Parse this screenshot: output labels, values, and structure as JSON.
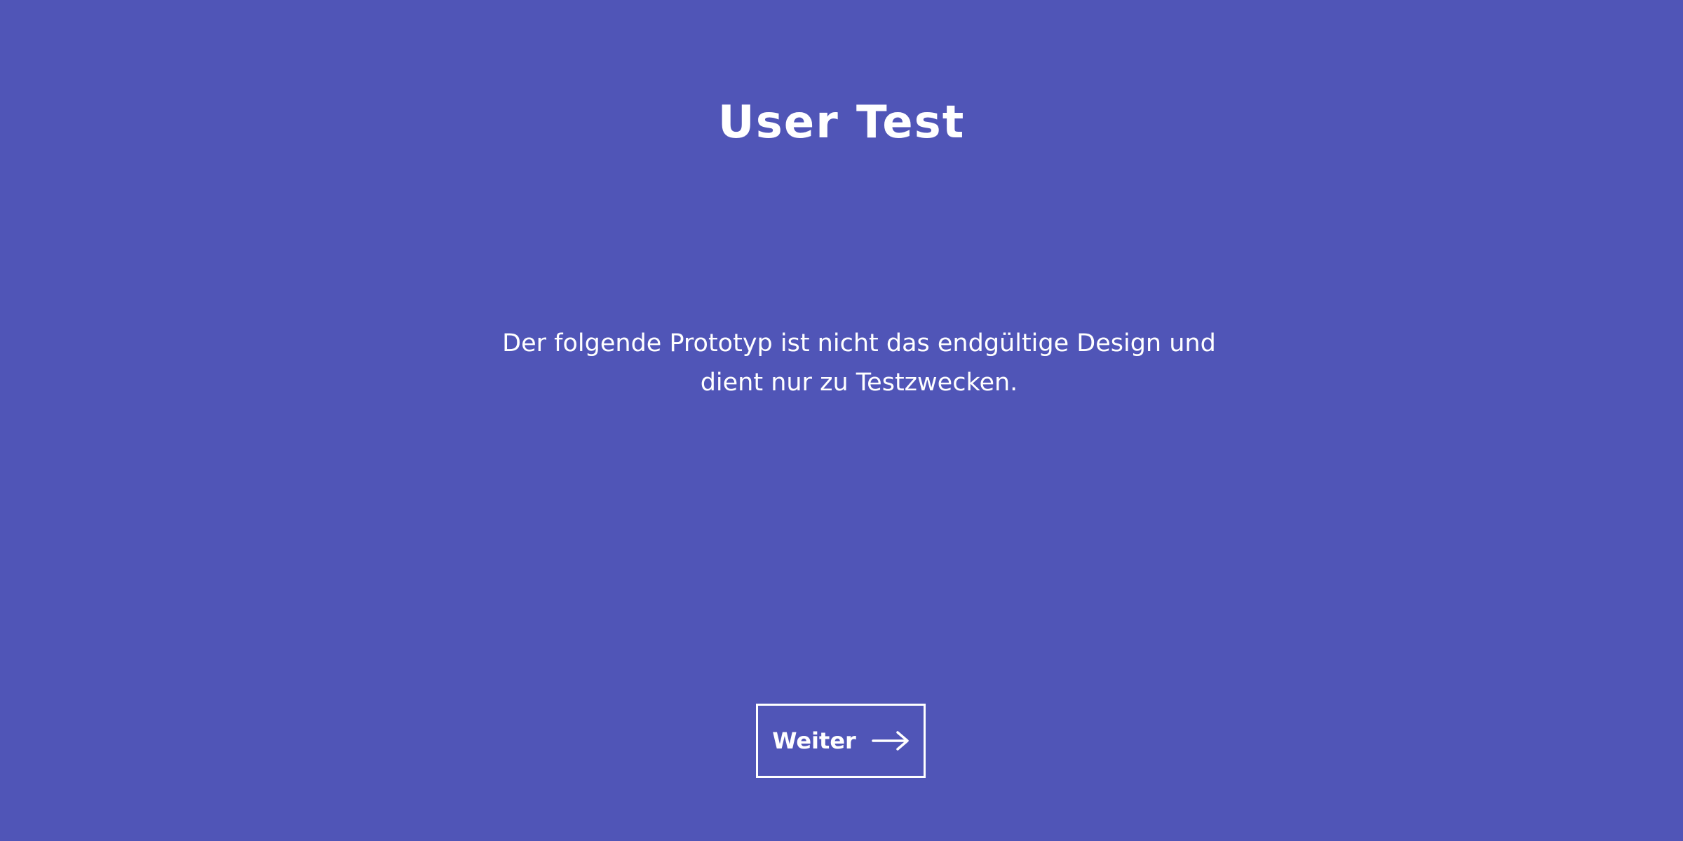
{
  "page": {
    "title": "User Test",
    "description": "Der folgende Prototyp ist nicht das endgültige Design und dient nur zu Testzwecken.",
    "background_color": "#5055b7",
    "text_color": "#ffffff"
  },
  "actions": {
    "next_label": "Weiter",
    "next_icon": "arrow-right-icon"
  }
}
